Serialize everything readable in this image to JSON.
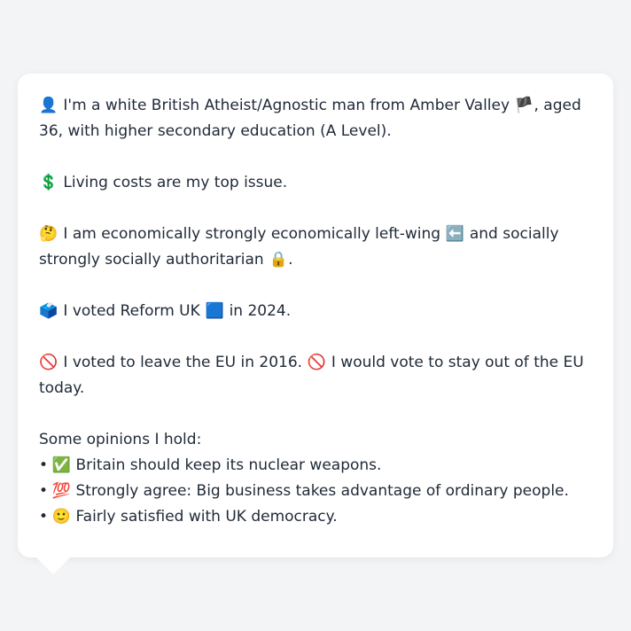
{
  "profile": {
    "intro": {
      "icon": "👤",
      "text_before_flag": "I'm a white British Atheist/Agnostic man from Amber Valley",
      "flag": "🏴",
      "text_after_flag": ", aged 36, with higher secondary education (A Level)."
    },
    "issue": {
      "icon": "💲",
      "text": "Living costs are my top issue."
    },
    "ideology": {
      "icon": "🤔",
      "text_part1": "I am economically strongly economically left-wing",
      "left_icon": "⬅️",
      "text_part2": "and socially strongly socially authoritarian",
      "lock_icon": "🔒",
      "text_part3": "."
    },
    "vote": {
      "icon": "🗳️",
      "text_part1": "I voted Reform UK",
      "party_icon": "🟦",
      "text_part2": "in 2024."
    },
    "eu": {
      "icon1": "🚫",
      "text1": "I voted to leave the EU in 2016.",
      "icon2": "🚫",
      "text2": "I would vote to stay out of the EU today."
    },
    "opinions": {
      "heading": "Some opinions I hold:",
      "bullet": "•",
      "items": [
        {
          "icon": "✅",
          "text": "Britain should keep its nuclear weapons."
        },
        {
          "icon": "💯",
          "text": "Strongly agree: Big business takes advantage of ordinary people."
        },
        {
          "icon": "🙂",
          "text": "Fairly satisfied with UK democracy."
        }
      ]
    }
  }
}
